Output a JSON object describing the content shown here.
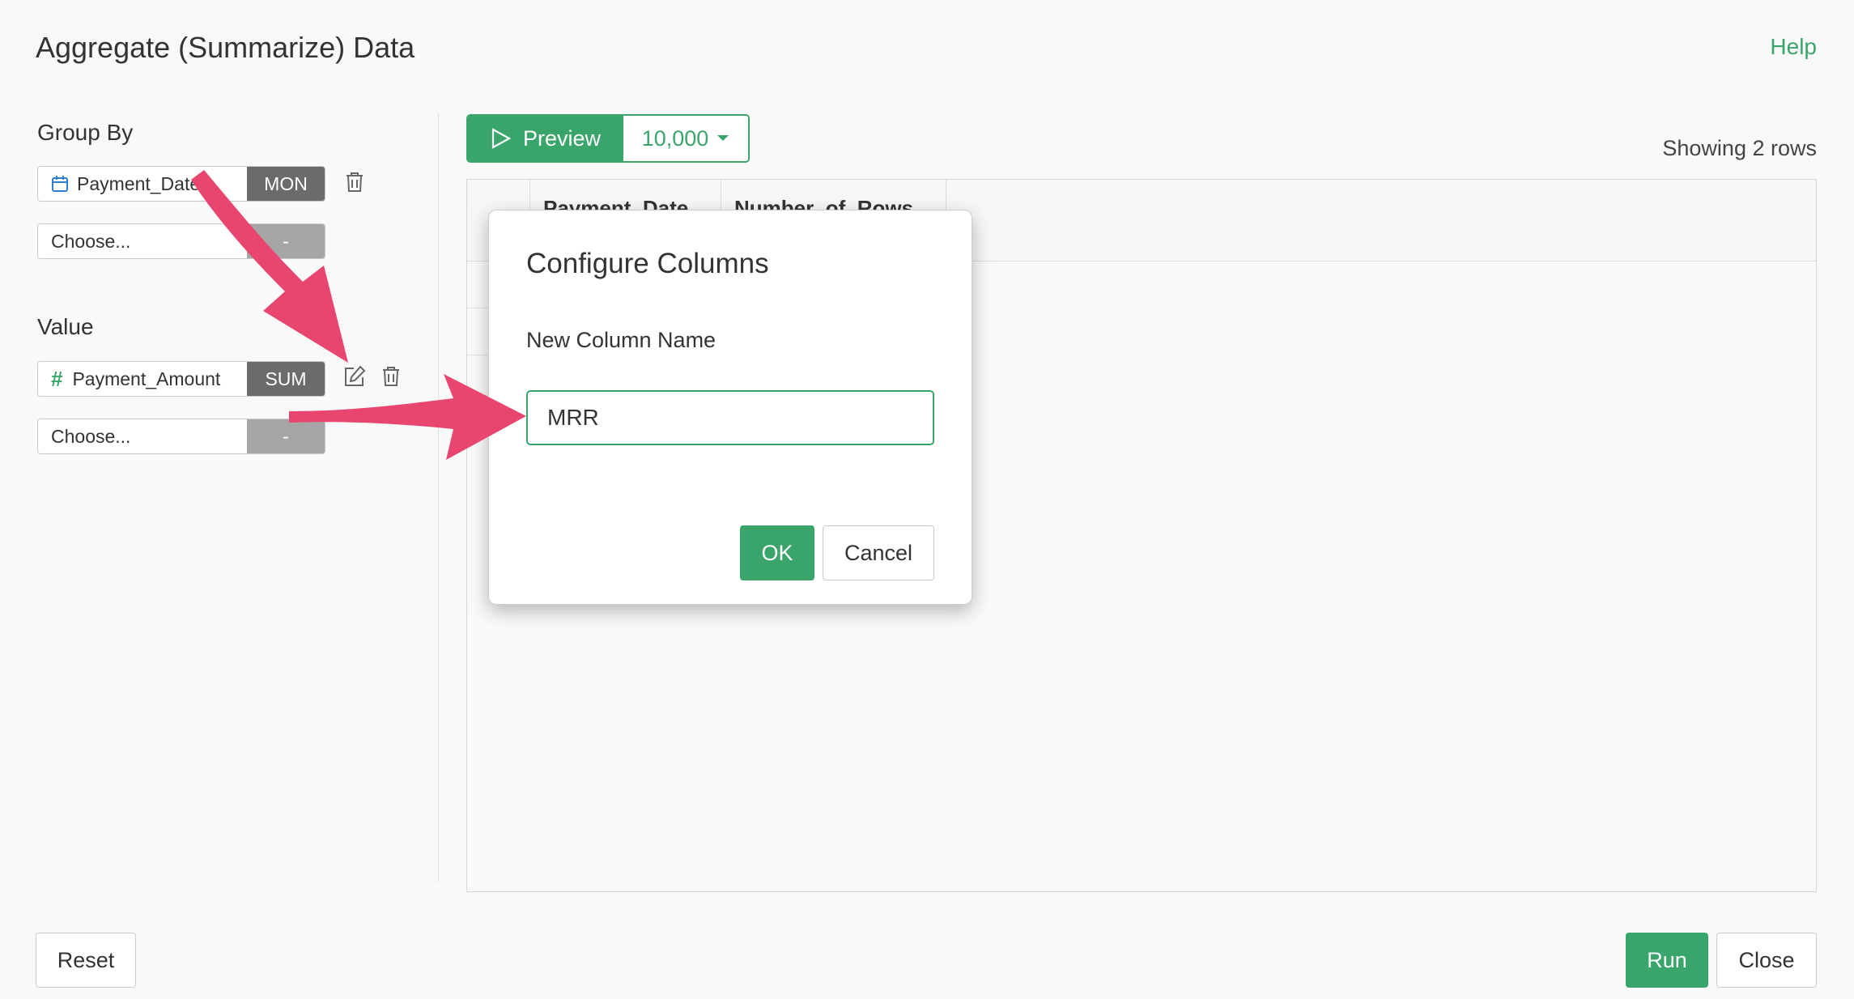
{
  "header": {
    "title": "Aggregate (Summarize) Data",
    "help_label": "Help"
  },
  "group_by": {
    "label": "Group By",
    "fields": [
      {
        "name": "Payment_Date",
        "type_icon": "calendar-icon",
        "agg": "MON"
      },
      {
        "name": "Choose...",
        "type_icon": "",
        "agg": "-"
      }
    ]
  },
  "value": {
    "label": "Value",
    "fields": [
      {
        "name": "Payment_Amount",
        "type_icon": "hash-icon",
        "type_glyph": "#",
        "agg": "SUM"
      },
      {
        "name": "Choose...",
        "type_icon": "",
        "agg": "-"
      }
    ]
  },
  "preview": {
    "button_label": "Preview",
    "rows_value": "10,000",
    "showing_text": "Showing 2 rows"
  },
  "table": {
    "columns": [
      "Payment_Date",
      "Number_of_Rows"
    ]
  },
  "modal": {
    "title": "Configure Columns",
    "field_label": "New Column Name",
    "field_value": "MRR",
    "ok_label": "OK",
    "cancel_label": "Cancel"
  },
  "footer": {
    "reset_label": "Reset",
    "run_label": "Run",
    "close_label": "Close"
  },
  "colors": {
    "accent": "#3aa56a",
    "annotation_arrow": "#e8456f",
    "agg_badge": "#6b6b6b"
  }
}
